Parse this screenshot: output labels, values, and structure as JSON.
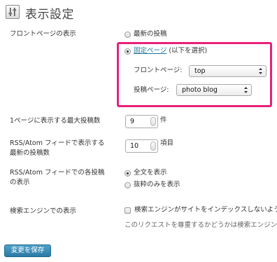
{
  "page": {
    "title": "表示設定"
  },
  "front_page": {
    "label": "フロントページの表示",
    "option_latest": "最新の投稿",
    "option_static_link": "固定ページ",
    "option_static_suffix": "(以下を選択)",
    "front_page_label": "フロントページ:",
    "front_page_value": "top",
    "posts_page_label": "投稿ページ:",
    "posts_page_value": "photo blog",
    "highlight_color": "#e8207a"
  },
  "posts_per_page": {
    "label": "1ページに表示する最大投稿数",
    "value": "9",
    "unit": "件"
  },
  "rss_items": {
    "label_line1": "RSS/Atom フィードで表示する",
    "label_line2": "最新の投稿数",
    "value": "10",
    "unit": "項目"
  },
  "rss_content": {
    "label_line1": "RSS/Atom フィードでの各投稿",
    "label_line2": "の表示",
    "option_full": "全文を表示",
    "option_summary": "抜粋のみを表示"
  },
  "search_engine": {
    "label": "検索エンジンでの表示",
    "checkbox_text": "検索エンジンがサイトをインデックスしないようにする",
    "note": "このリクエストを尊重するかどうかは検索エンジンの設定によります。"
  },
  "save_button": {
    "label": "変更を保存",
    "color": "#2a7aa5"
  }
}
